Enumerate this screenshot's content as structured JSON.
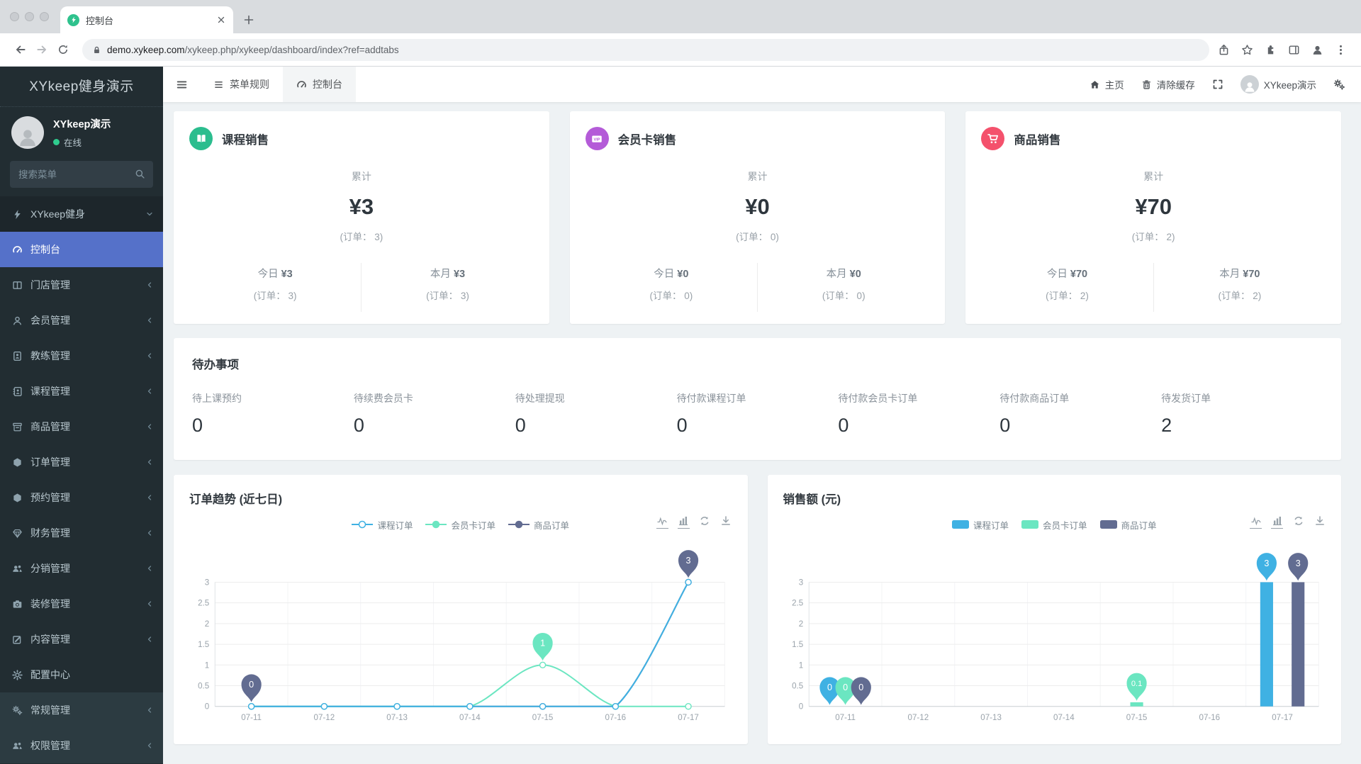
{
  "browser": {
    "tab_title": "控制台",
    "url": {
      "domain": "demo.xykeep.com",
      "path": "/xykeep.php/xykeep/dashboard/index?ref=addtabs"
    }
  },
  "sidebar": {
    "brand": "XYkeep健身演示",
    "user": {
      "name": "XYkeep演示",
      "status": "在线",
      "status_color": "#2fcc8e"
    },
    "search_placeholder": "搜索菜单",
    "menu": [
      {
        "id": "xykeep",
        "label": "XYkeep健身",
        "icon": "bolt-icon",
        "chevron": "down",
        "variant": "dark"
      },
      {
        "id": "dashboard",
        "label": "控制台",
        "icon": "gauge-icon",
        "active": true
      },
      {
        "id": "store",
        "label": "门店管理",
        "icon": "columns-icon",
        "chevron": "left"
      },
      {
        "id": "member",
        "label": "会员管理",
        "icon": "person-icon",
        "chevron": "left"
      },
      {
        "id": "coach",
        "label": "教练管理",
        "icon": "badge-icon",
        "chevron": "left"
      },
      {
        "id": "course",
        "label": "课程管理",
        "icon": "address-book-icon",
        "chevron": "left"
      },
      {
        "id": "goods",
        "label": "商品管理",
        "icon": "archive-icon",
        "chevron": "left"
      },
      {
        "id": "order",
        "label": "订单管理",
        "icon": "hexagon-icon",
        "chevron": "left"
      },
      {
        "id": "booking",
        "label": "预约管理",
        "icon": "hexagon-icon",
        "chevron": "left"
      },
      {
        "id": "finance",
        "label": "财务管理",
        "icon": "gem-icon",
        "chevron": "left"
      },
      {
        "id": "distribution",
        "label": "分销管理",
        "icon": "users-icon",
        "chevron": "left"
      },
      {
        "id": "decorate",
        "label": "装修管理",
        "icon": "camera-icon",
        "chevron": "left"
      },
      {
        "id": "content",
        "label": "内容管理",
        "icon": "pencil-icon",
        "chevron": "left"
      },
      {
        "id": "config",
        "label": "配置中心",
        "icon": "gear-icon"
      },
      {
        "id": "general",
        "label": "常规管理",
        "icon": "gears-icon",
        "chevron": "left",
        "variant": "light"
      },
      {
        "id": "auth",
        "label": "权限管理",
        "icon": "users-icon",
        "chevron": "left",
        "variant": "light"
      }
    ]
  },
  "topbar": {
    "tabs": [
      {
        "id": "menu-rules",
        "label": "菜单规则",
        "icon": "list-icon"
      },
      {
        "id": "dashboard",
        "label": "控制台",
        "icon": "gauge-icon",
        "active": true
      }
    ],
    "home": "主页",
    "clear_cache": "清除缓存",
    "username": "XYkeep演示"
  },
  "stat_cards": [
    {
      "id": "course-sales",
      "title": "课程销售",
      "icon": "open-book-icon",
      "color": "#2bbd8e",
      "total_label": "累计",
      "total": "¥3",
      "total_orders": "(订单： 3)",
      "today_label": "今日",
      "today_value": "¥3",
      "today_orders": "(订单： 3)",
      "month_label": "本月",
      "month_value": "¥3",
      "month_orders": "(订单： 3)"
    },
    {
      "id": "membercard-sales",
      "title": "会员卡销售",
      "icon": "vip-card-icon",
      "color": "#b45bd8",
      "total_label": "累计",
      "total": "¥0",
      "total_orders": "(订单： 0)",
      "today_label": "今日",
      "today_value": "¥0",
      "today_orders": "(订单： 0)",
      "month_label": "本月",
      "month_value": "¥0",
      "month_orders": "(订单： 0)"
    },
    {
      "id": "goods-sales",
      "title": "商品销售",
      "icon": "cart-icon",
      "color": "#f4516c",
      "total_label": "累计",
      "total": "¥70",
      "total_orders": "(订单： 2)",
      "today_label": "今日",
      "today_value": "¥70",
      "today_orders": "(订单： 2)",
      "month_label": "本月",
      "month_value": "¥70",
      "month_orders": "(订单： 2)"
    }
  ],
  "todo": {
    "title": "待办事项",
    "items": [
      {
        "label": "待上课预约",
        "value": "0"
      },
      {
        "label": "待续费会员卡",
        "value": "0"
      },
      {
        "label": "待处理提现",
        "value": "0"
      },
      {
        "label": "待付款课程订单",
        "value": "0"
      },
      {
        "label": "待付款会员卡订单",
        "value": "0"
      },
      {
        "label": "待付款商品订单",
        "value": "0"
      },
      {
        "label": "待发货订单",
        "value": "2"
      }
    ]
  },
  "chart_data": [
    {
      "type": "line",
      "title": "订单趋势 (近七日)",
      "categories": [
        "07-11",
        "07-12",
        "07-13",
        "07-14",
        "07-15",
        "07-16",
        "07-17"
      ],
      "series": [
        {
          "name": "课程订单",
          "color": "#3fb1e3",
          "symbol": "hollow",
          "values": [
            0,
            0,
            0,
            0,
            0,
            0,
            3
          ]
        },
        {
          "name": "会员卡订单",
          "color": "#6be6c1",
          "symbol": "filled",
          "values": [
            0,
            0,
            0,
            0,
            1,
            0,
            0
          ]
        },
        {
          "name": "商品订单",
          "color": "#626c91",
          "symbol": "filled",
          "values": [
            0,
            0,
            0,
            0,
            0,
            0,
            3
          ]
        }
      ],
      "ylim": [
        0,
        3
      ],
      "ytick_step": 0.5,
      "grid": true,
      "legend_position": "top-center",
      "annotations": [
        {
          "label": "0",
          "category": "07-11",
          "value": 0,
          "color": "#626c91"
        },
        {
          "label": "1",
          "category": "07-15",
          "value": 1,
          "color": "#6be6c1"
        },
        {
          "label": "3",
          "category": "07-17",
          "value": 3,
          "color": "#626c91"
        }
      ]
    },
    {
      "type": "bar",
      "title": "销售额 (元)",
      "categories": [
        "07-11",
        "07-12",
        "07-13",
        "07-14",
        "07-15",
        "07-16",
        "07-17"
      ],
      "series": [
        {
          "name": "课程订单",
          "color": "#3fb1e3",
          "values": [
            0,
            0,
            0,
            0,
            0,
            0,
            3
          ]
        },
        {
          "name": "会员卡订单",
          "color": "#6be6c1",
          "values": [
            0,
            0,
            0,
            0,
            0.1,
            0,
            0
          ]
        },
        {
          "name": "商品订单",
          "color": "#626c91",
          "values": [
            0,
            0,
            0,
            0,
            0,
            0,
            3
          ]
        }
      ],
      "ylim": [
        0,
        3
      ],
      "ytick_step": 0.5,
      "grid": true,
      "legend_position": "top-center",
      "annotations": [
        {
          "label": "0",
          "category": "07-11",
          "series": 0,
          "value": 0
        },
        {
          "label": "0",
          "category": "07-11",
          "series": 1,
          "value": 0
        },
        {
          "label": "0",
          "category": "07-11",
          "series": 2,
          "value": 0
        },
        {
          "label": "0.1",
          "category": "07-15",
          "series": 1,
          "value": 0.1
        },
        {
          "label": "3",
          "category": "07-17",
          "series": 0,
          "value": 3
        },
        {
          "label": "3",
          "category": "07-17",
          "series": 2,
          "value": 3
        }
      ]
    }
  ]
}
